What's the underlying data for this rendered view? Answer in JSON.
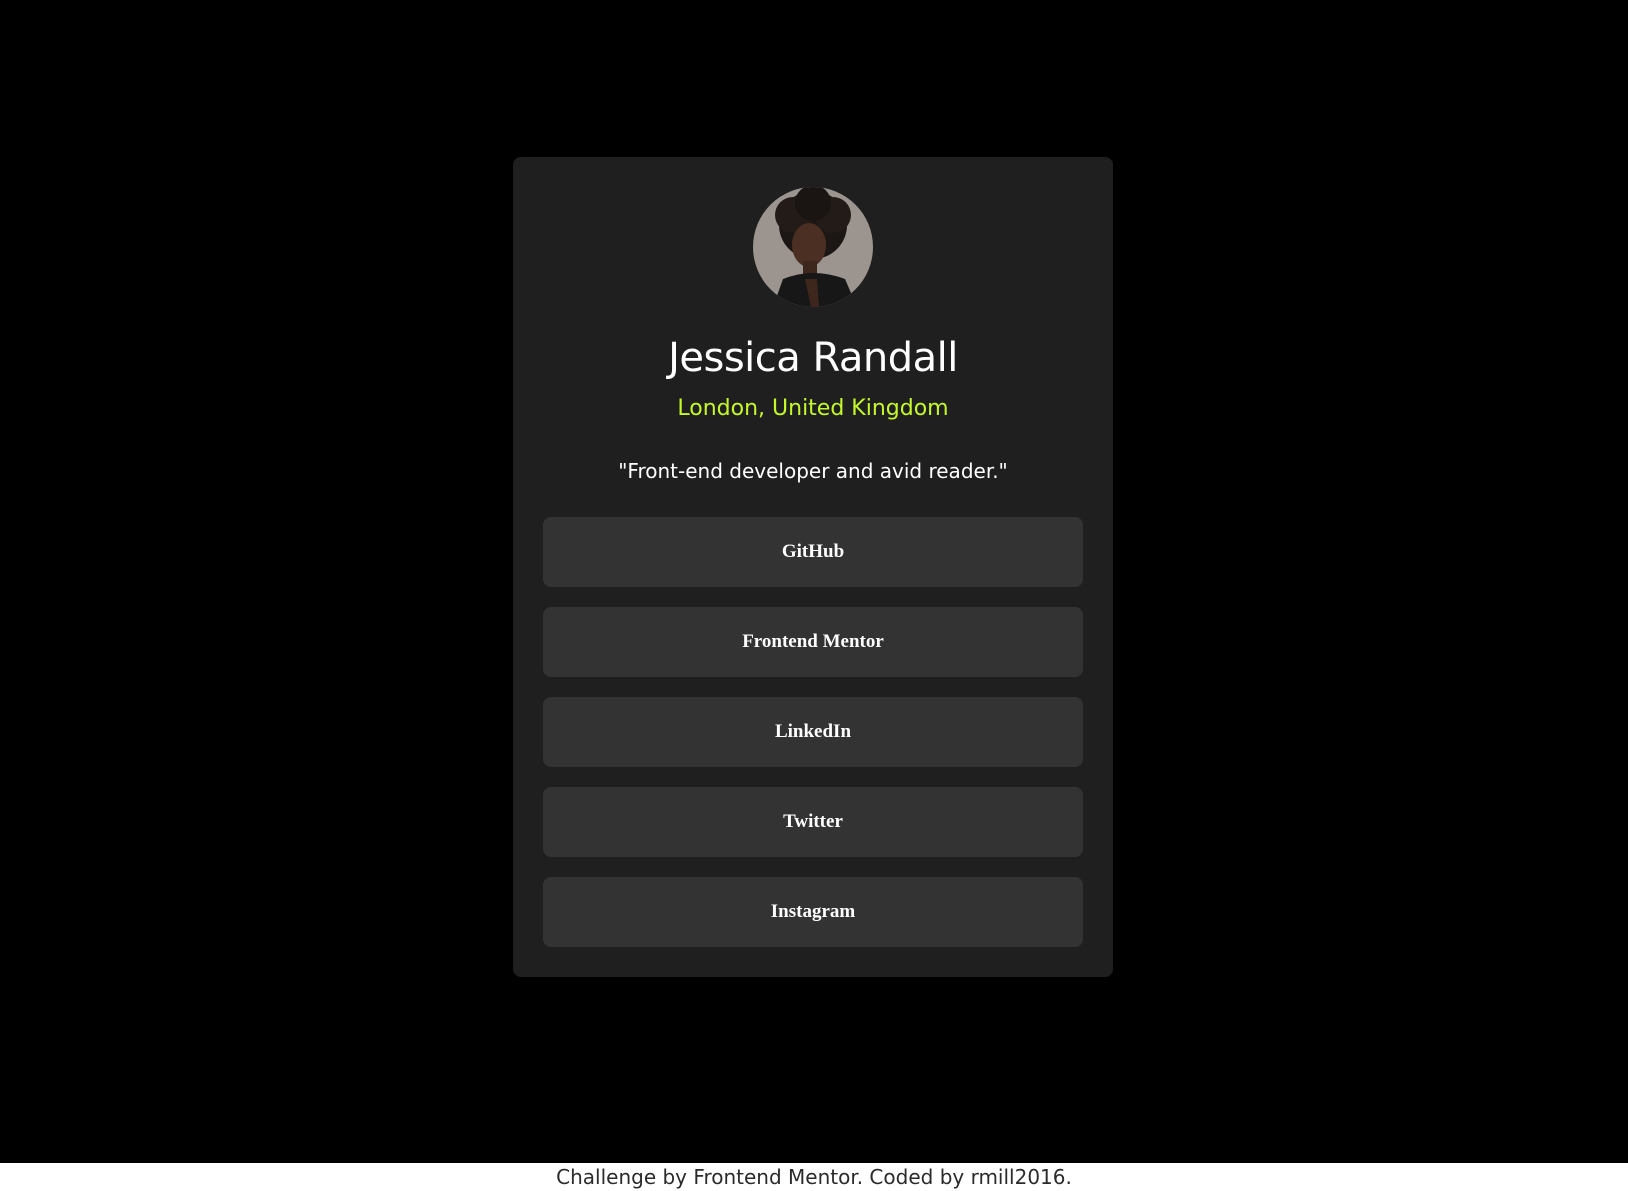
{
  "profile": {
    "name": "Jessica Randall",
    "location": "London, United Kingdom",
    "bio": "\"Front-end developer and avid reader.\""
  },
  "links": [
    {
      "label": "GitHub"
    },
    {
      "label": "Frontend Mentor"
    },
    {
      "label": "LinkedIn"
    },
    {
      "label": "Twitter"
    },
    {
      "label": "Instagram"
    }
  ],
  "footer": {
    "prefix": "Challenge by",
    "challenge_link": "Frontend Mentor",
    "middle": ". Coded by",
    "author_link": "rmill2016",
    "suffix": "."
  },
  "colors": {
    "background": "#000000",
    "card": "#1f1f1f",
    "button": "#333333",
    "accent": "#c4f82a",
    "text": "#ffffff"
  }
}
